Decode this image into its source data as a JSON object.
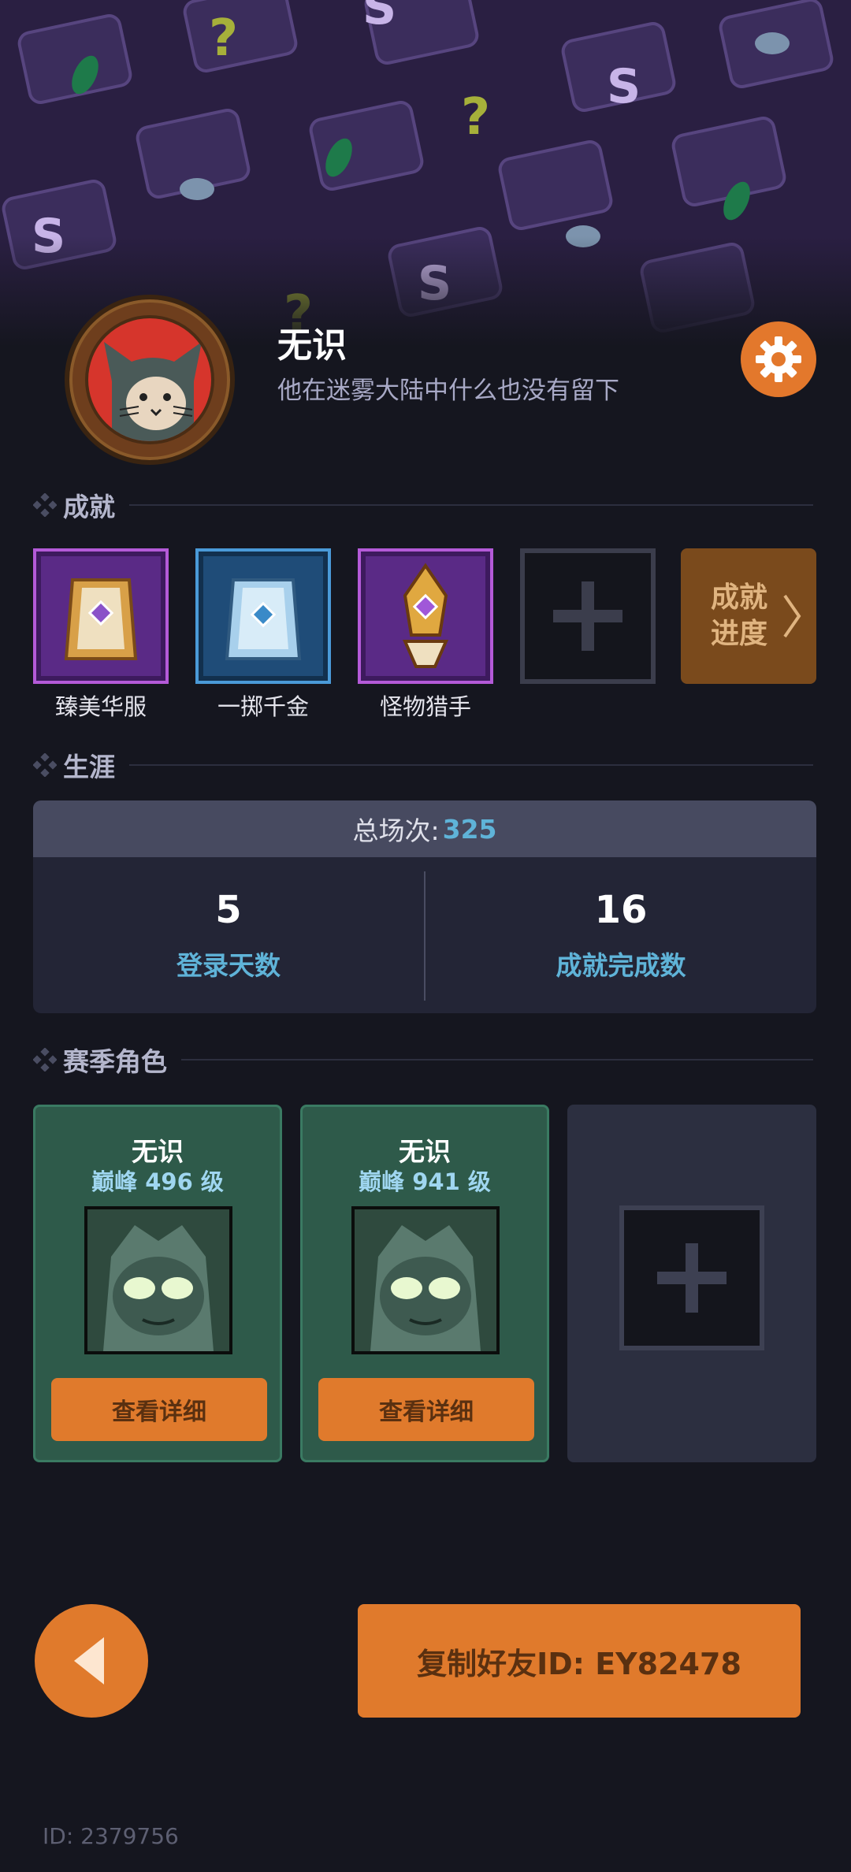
{
  "colors": {
    "background": "#15161f",
    "banner": "#2a1f42",
    "accent_orange": "#e07a2c",
    "accent_blue": "#5fb3d8",
    "card_green": "#2e5a4a",
    "avatar_red": "#d6352c"
  },
  "profile": {
    "name": "无识",
    "bio": "他在迷雾大陆中什么也没有留下",
    "avatar_icon": "cat-avatar-icon",
    "settings_icon": "gear-icon"
  },
  "achievements": {
    "title": "成就",
    "items": [
      {
        "label": "臻美华服",
        "icon": "wardrobe-card-icon"
      },
      {
        "label": "一掷千金",
        "icon": "gold-card-icon"
      },
      {
        "label": "怪物猎手",
        "icon": "sword-trophy-icon"
      }
    ],
    "add_icon": "plus-icon",
    "progress_line1": "成就",
    "progress_line2": "进度"
  },
  "career": {
    "title": "生涯",
    "total_label": "总场次:",
    "total_value": "325",
    "stats": [
      {
        "value": "5",
        "label": "登录天数"
      },
      {
        "value": "16",
        "label": "成就完成数"
      }
    ]
  },
  "season": {
    "title": "赛季角色",
    "characters": [
      {
        "name": "无识",
        "level": "巅峰 496 级",
        "button": "查看详细"
      },
      {
        "name": "无识",
        "level": "巅峰 941 级",
        "button": "查看详细"
      }
    ]
  },
  "bottom": {
    "back_icon": "back-arrow-icon",
    "copy_button": "复制好友ID: EY82478",
    "footer_id": "ID: 2379756"
  }
}
